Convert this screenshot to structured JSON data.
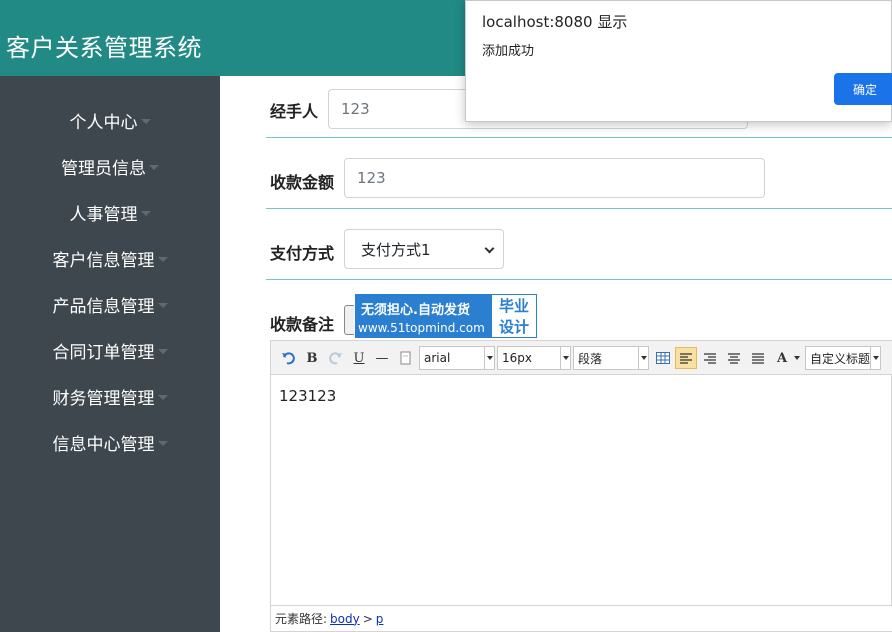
{
  "app": {
    "title": "客户关系管理系统"
  },
  "sidebar": {
    "items": [
      {
        "label": "个人中心"
      },
      {
        "label": "管理员信息"
      },
      {
        "label": "人事管理"
      },
      {
        "label": "客户信息管理"
      },
      {
        "label": "产品信息管理"
      },
      {
        "label": "合同订单管理"
      },
      {
        "label": "财务管理管理"
      },
      {
        "label": "信息中心管理"
      }
    ]
  },
  "form": {
    "handler": {
      "label": "经手人",
      "value": "123"
    },
    "amount": {
      "label": "收款金额",
      "value": "123"
    },
    "payment": {
      "label": "支付方式",
      "selected": "支付方式1"
    },
    "remark": {
      "label": "收款备注"
    }
  },
  "editor": {
    "toolbar": {
      "bold": "B",
      "underline": "U",
      "hr": "—",
      "font_family": "arial",
      "font_size": "16px",
      "paragraph": "段落",
      "font_color": "A",
      "custom_title": "自定义标题"
    },
    "content": "123123",
    "path": {
      "label": "元素路径:",
      "body": "body",
      "sep": ">",
      "p": "p"
    }
  },
  "watermark": {
    "line1": "无须担心.自动发货",
    "line2": "www.51topmind.com",
    "side1": "毕业",
    "side2": "设计"
  },
  "dialog": {
    "title": "localhost:8080 显示",
    "message": "添加成功",
    "ok_label": "确定"
  },
  "colors": {
    "header": "#218a84",
    "sidebar": "#3f474e",
    "accent": "#1a73e8"
  }
}
